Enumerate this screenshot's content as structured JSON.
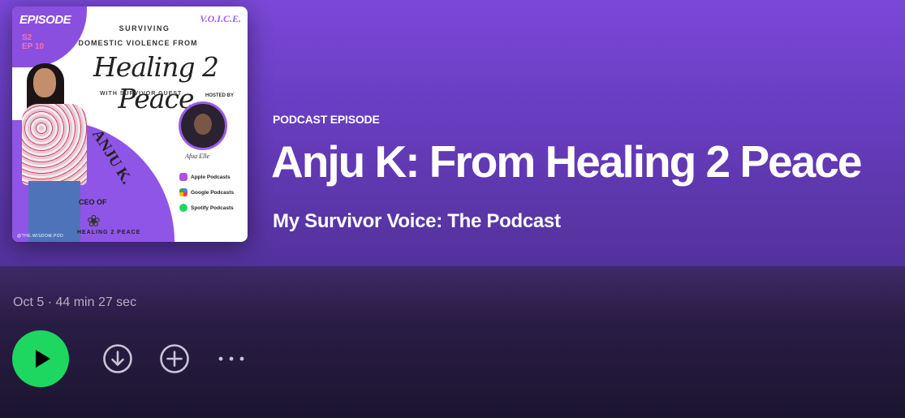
{
  "episode": {
    "type_label": "PODCAST EPISODE",
    "title": "Anju K: From Healing 2 Peace",
    "show_name": "My Survivor Voice: The Podcast",
    "date": "Oct 5",
    "separator": "·",
    "duration": "44 min 27 sec"
  },
  "cover_art": {
    "episode_tag": "EPISODE",
    "season": "S2",
    "episode_number": "EP 10",
    "brand": "V.O.I.C.E.",
    "line1": "SURVIVING",
    "line2": "DOMESTIC VIOLENCE FROM",
    "script_title": "Healing 2 Peace",
    "with_guest": "WITH SURVIVOR GUEST",
    "hosted_by": "HOSTED BY",
    "host_signature": "Afua Elle",
    "guest_name": "ANJU K.",
    "ceo_of": "CEO OF",
    "company": "HEALING 2 PEACE",
    "badges": [
      "Apple Podcasts",
      "Google Podcasts",
      "Spotify Podcasts"
    ],
    "handle": "@THE.WISDOM.POD"
  },
  "actions": {
    "play_icon": "play-icon",
    "download_icon": "download-circle-icon",
    "add_icon": "plus-circle-icon",
    "more_icon": "more-horizontal-icon"
  },
  "colors": {
    "accent": "#1ed760",
    "hero_top": "#7a48d8",
    "hero_bottom": "#5a36a8",
    "background": "#1b1530",
    "meta_text": "#b3aec4"
  }
}
